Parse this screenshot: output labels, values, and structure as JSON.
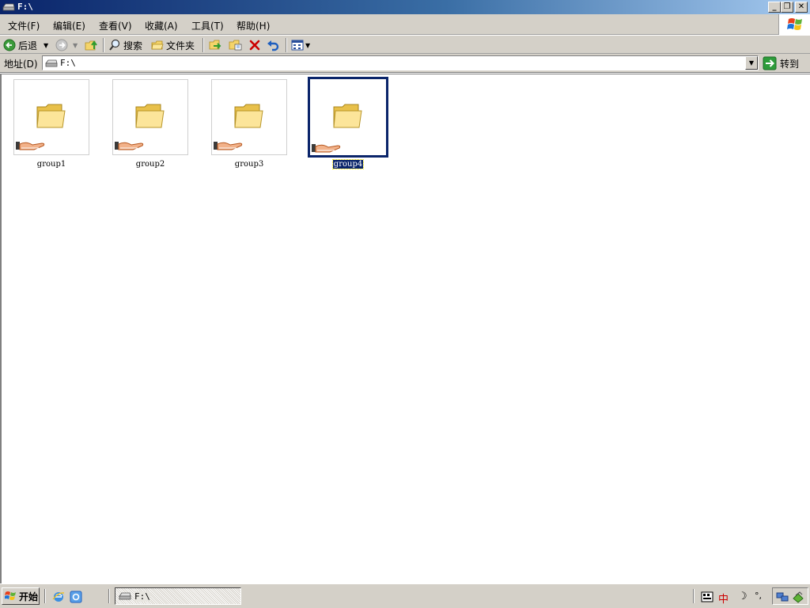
{
  "window": {
    "title": "F:\\",
    "buttons": {
      "minimize": "_",
      "restore": "❐",
      "close": "✕"
    }
  },
  "menu": [
    {
      "label": "文件(F)"
    },
    {
      "label": "编辑(E)"
    },
    {
      "label": "查看(V)"
    },
    {
      "label": "收藏(A)"
    },
    {
      "label": "工具(T)"
    },
    {
      "label": "帮助(H)"
    }
  ],
  "toolbar": {
    "back_label": "后退",
    "search_label": "搜索",
    "folders_label": "文件夹"
  },
  "address": {
    "label": "地址(D)",
    "value": "F:\\",
    "go_label": "转到"
  },
  "folders": [
    {
      "name": "group1",
      "selected": false
    },
    {
      "name": "group2",
      "selected": false
    },
    {
      "name": "group3",
      "selected": false
    },
    {
      "name": "group4",
      "selected": true
    }
  ],
  "taskbar": {
    "start_label": "开始",
    "task_label": "F:\\",
    "ime": {
      "lang": "中",
      "moon": "☽",
      "punct": "°,"
    }
  },
  "colors": {
    "titlebar_start": "#0a246a",
    "titlebar_end": "#a6caf0",
    "chrome": "#d4d0c8",
    "selection": "#0a246a",
    "delete_red": "#cc0000",
    "go_green": "#2d9c3a"
  },
  "icons": {
    "back": "back-arrow-icon",
    "forward": "forward-arrow-icon",
    "up": "up-folder-icon",
    "search": "search-icon",
    "folders": "folders-icon",
    "move_to": "move-to-icon",
    "copy_to": "copy-to-icon",
    "delete": "delete-icon",
    "undo": "undo-icon",
    "views": "views-icon",
    "folder": "folder-icon",
    "shared": "shared-hand-icon"
  }
}
